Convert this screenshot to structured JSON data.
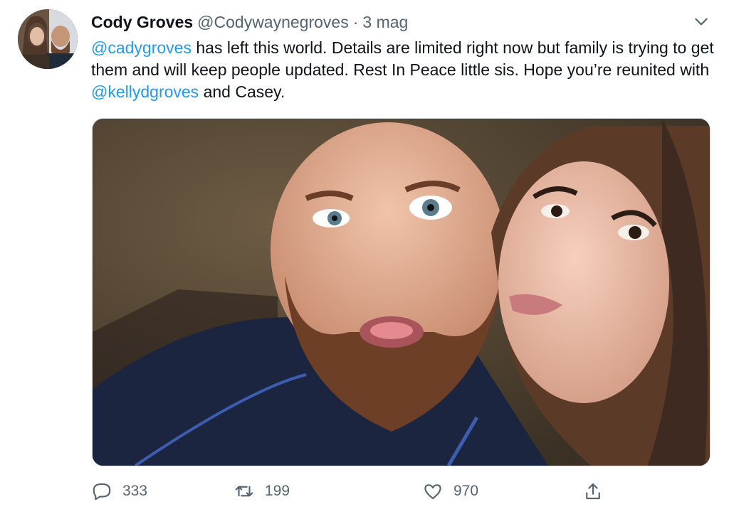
{
  "tweet": {
    "author_name": "Cody Groves",
    "author_handle": "@Codywaynegroves",
    "separator": "·",
    "time": "3 mag",
    "text": {
      "mention_1": "@cadygroves",
      "part_1": " has left this world. Details are limited right now but family is trying to get them and will keep people updated. Rest In Peace little sis. Hope you’re reunited with ",
      "mention_2": "@kellydgroves",
      "part_2": " and Casey."
    }
  },
  "actions": {
    "reply_count": "333",
    "retweet_count": "199",
    "like_count": "970"
  },
  "icons": {
    "more": "chevron-down-icon",
    "reply": "comment-icon",
    "retweet": "retweet-icon",
    "like": "heart-icon",
    "share": "share-icon"
  },
  "colors": {
    "text": "#0f1419",
    "secondary": "#536471",
    "link": "#1d9bf0"
  }
}
